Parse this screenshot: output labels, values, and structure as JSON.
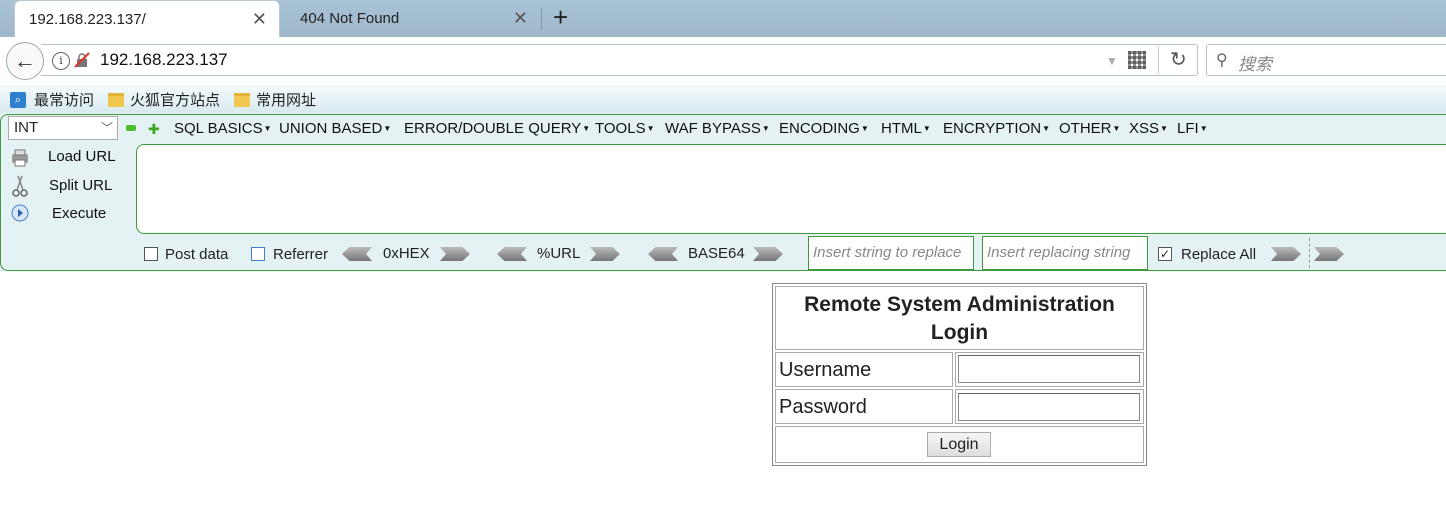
{
  "tabs": [
    {
      "title": "192.168.223.137/",
      "active": true
    },
    {
      "title": "404 Not Found",
      "active": false
    }
  ],
  "address_bar": {
    "url": "192.168.223.137"
  },
  "search_bar": {
    "placeholder": "搜索"
  },
  "bookmarks": [
    {
      "label": "最常访问",
      "icon": "most-visited-icon"
    },
    {
      "label": "火狐官方站点",
      "icon": "folder-icon"
    },
    {
      "label": "常用网址",
      "icon": "folder-icon"
    }
  ],
  "hackbar": {
    "select_value": "INT",
    "menus": [
      "SQL BASICS",
      "UNION BASED",
      "ERROR/DOUBLE QUERY",
      "TOOLS",
      "WAF BYPASS",
      "ENCODING",
      "HTML",
      "ENCRYPTION",
      "OTHER",
      "XSS",
      "LFI"
    ],
    "load_url": "Load URL",
    "split_url": "Split URL",
    "execute": "Execute",
    "post_data": "Post data",
    "referrer": "Referrer",
    "hex": "0xHEX",
    "url_enc": "%URL",
    "base64": "BASE64",
    "replace_placeholder": "Insert string to replace",
    "replacing_placeholder": "Insert replacing string",
    "replace_all": "Replace All",
    "replace_all_checked": true,
    "post_data_checked": false,
    "referrer_checked": false
  },
  "page": {
    "title": "Remote System Administration Login",
    "title_line1": "Remote System Administration",
    "title_line2": "Login",
    "username_label": "Username",
    "password_label": "Password",
    "username_value": "",
    "password_value": "",
    "login_button": "Login"
  }
}
